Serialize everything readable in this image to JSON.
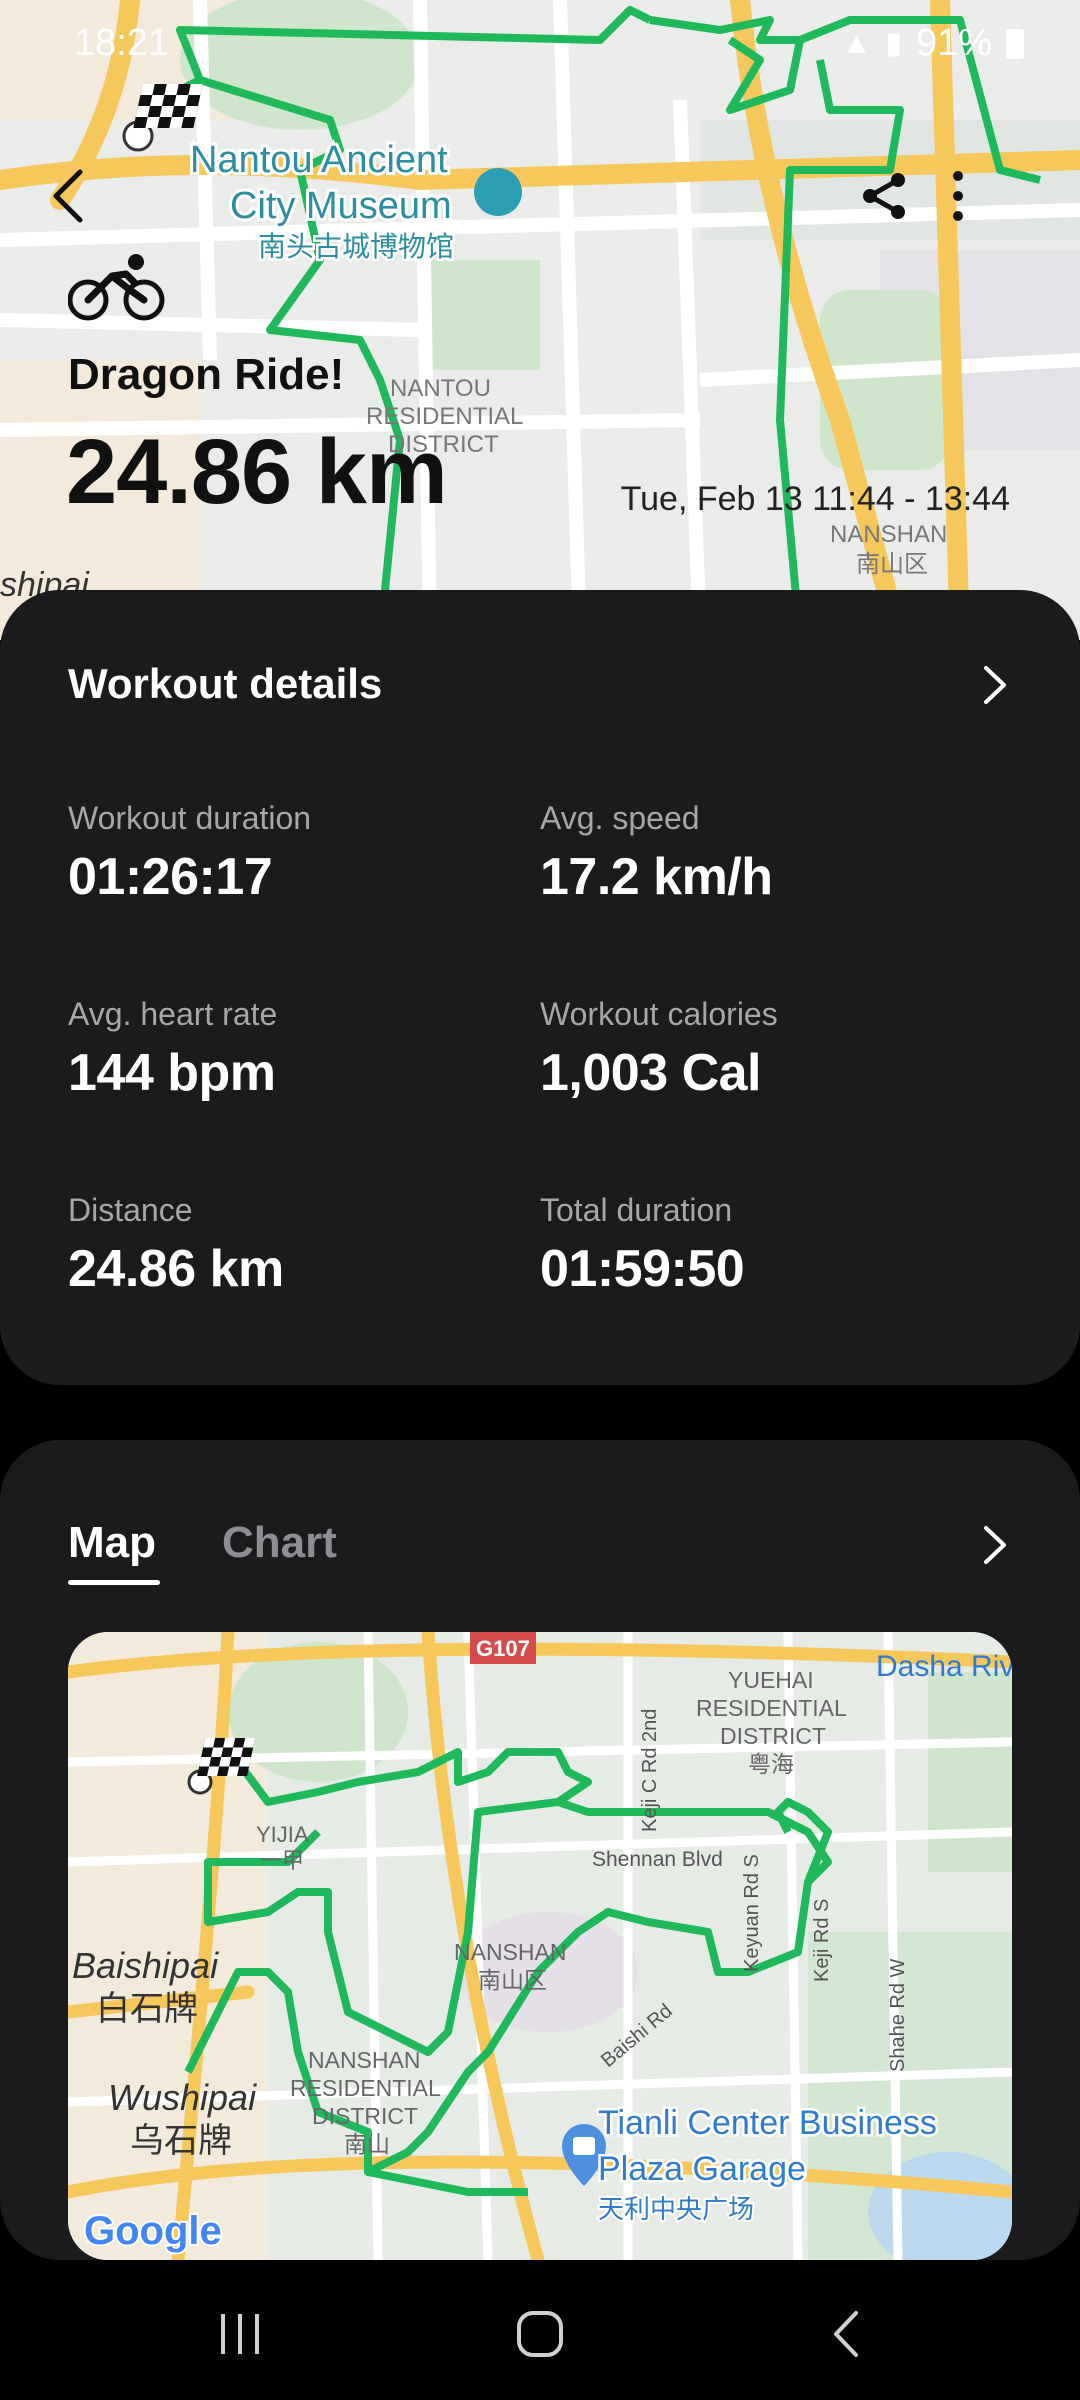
{
  "status_bar": {
    "time": "18:21",
    "battery": "91%"
  },
  "header": {
    "activity_icon": "cycling-icon",
    "title": "Dragon Ride!",
    "distance": "24.86 km",
    "datetime": "Tue, Feb 13 11:44 - 13:44",
    "map_labels": {
      "museum_en": "Nantou Ancient",
      "museum_en2": "City Museum",
      "museum_cn": "南头古城博物馆",
      "district1": "NANTOU",
      "district2": "RESIDENTIAL",
      "district3": "DISTRICT",
      "nanshan": "NANSHAN",
      "nanshan_cn": "南山区",
      "shipai": "shipai"
    }
  },
  "details": {
    "title": "Workout details",
    "stats": [
      {
        "label": "Workout duration",
        "value": "01:26:17"
      },
      {
        "label": "Avg. speed",
        "value": "17.2 km/h"
      },
      {
        "label": "Avg. heart rate",
        "value": "144 bpm"
      },
      {
        "label": "Workout calories",
        "value": "1,003 Cal"
      },
      {
        "label": "Distance",
        "value": "24.86 km"
      },
      {
        "label": "Total duration",
        "value": "01:59:50"
      }
    ]
  },
  "mapcard": {
    "tabs": [
      "Map",
      "Chart"
    ],
    "active_tab": "Map",
    "map_labels": {
      "g107": "G107",
      "dasha": "Dasha Riv",
      "yuehai1": "YUEHAI",
      "yuehai2": "RESIDENTIAL",
      "yuehai3": "DISTRICT",
      "yuehai_cn": "粤海",
      "keji_c": "Keji C Rd 2nd",
      "yijia": "YIJIA",
      "yijia_cn": "一甲",
      "shennan": "Shennan Blvd",
      "baishipai": "Baishipai",
      "baishipai_cn": "白石牌",
      "nanshan": "NANSHAN",
      "nanshan_cn": "南山区",
      "keyuan": "Keyuan Rd S",
      "keji_s": "Keji Rd S",
      "shahe": "Shahe Rd W",
      "baishi_rd": "Baishi Rd",
      "nanshan_res1": "NANSHAN",
      "nanshan_res2": "RESIDENTIAL",
      "nanshan_res3": "DISTRICT",
      "nanshan_res_cn": "南山",
      "wushipai": "Wushipai",
      "wushipai_cn": "乌石牌",
      "tianli1": "Tianli Center Business",
      "tianli2": "Plaza Garage",
      "tianli_cn": "天利中央广场",
      "google": "Google"
    }
  },
  "colors": {
    "route": "#1fb85a",
    "card_bg": "#1b1b1d",
    "map_bg": "#e9ece8",
    "road_yellow": "#f6c75a"
  }
}
